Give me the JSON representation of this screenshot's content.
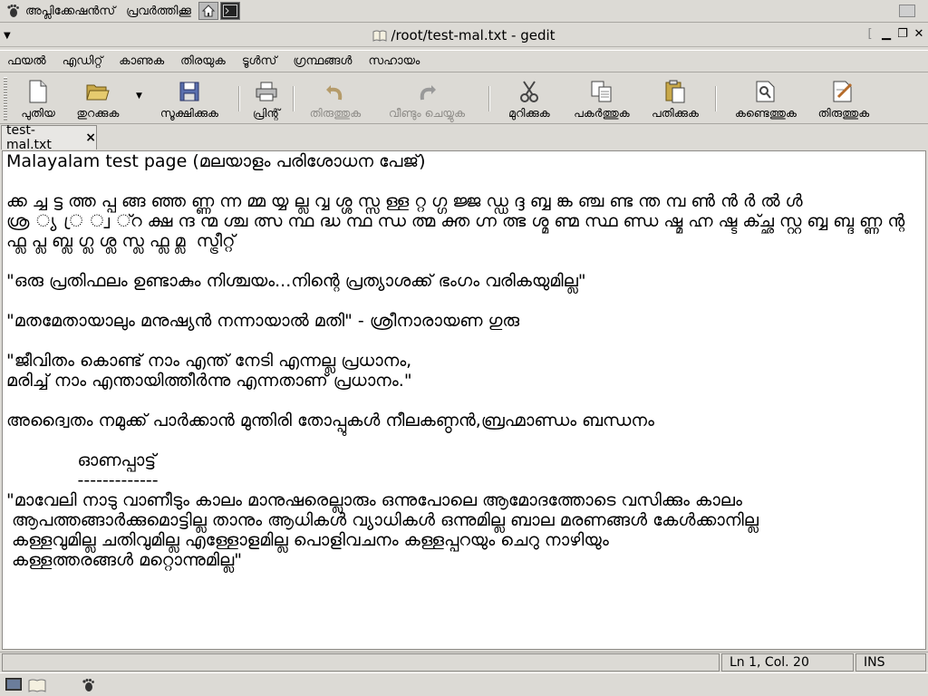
{
  "top_panel": {
    "applications_label": "അപ്ലിക്കേഷന്‍സ്",
    "actions_label": "പ്രവര്‍ത്തിക്കൂ",
    "icons": [
      "gnome-foot-icon",
      "home-launcher-icon",
      "terminal-launcher-icon",
      "network-status-icon"
    ]
  },
  "window": {
    "title": "/root/test-mal.txt - gedit"
  },
  "menubar": {
    "items": [
      "ഫയല്‍",
      "എഡിറ്റ്",
      "കാണുക",
      "തിരയുക",
      "ടൂള്‍സ്",
      "ഗ്രന്ഥങ്ങള്‍",
      "സഹായം"
    ]
  },
  "toolbar": {
    "new": "പുതിയ",
    "open": "തുറക്കുക",
    "save": "സൂക്ഷിക്കുക",
    "print": "പ്രിന്റ്",
    "undo": "തിരുത്തുക",
    "redo": "വീണ്ടും ചെയ്യുക",
    "cut": "മുറിക്കുക",
    "copy": "പകര്‍ത്തുക",
    "paste": "പതിക്കുക",
    "find": "കണ്ടെത്തുക",
    "replace": "തിരുത്തുക"
  },
  "tab": {
    "label": "test-mal.txt",
    "close": "×"
  },
  "editor": {
    "lines": [
      "Malayalam test page (മലയാളം പരിശോധന പേജ്)",
      "",
      "ക്ക ച്ച ട്ട ത്ത പ്പ ങ്ങ ഞ്ഞ ണ്ണ ന്ന മ്മ യ്യ ല്ല വ്വ ശ്ശ സ്സ ള്ള റ്റ ഗ്ഗ ജ്ജ ഡ്ഡ ദ്ദ ബ്ബ ങ്ക ഞ്ച ണ്ട ന്ത മ്പ ണ്‍ ന്‍ ര്‍ ല്‍ ള്‍",
      "ശ്ര ്യ ്ര ്വ ്റ ക്ഷ ന്ദ ന്മ ശ്ച ത്സ ന്ഥ ദ്ധ ന്ഥ ന്ധ ത്മ ക്ത ഗ്ന ത്ഭ ശ്മ ണ്മ സ്ഥ ണ്ഡ ഷ്മ ഹ്ന ഷ്ട ക്ച്ഛ സ്റ്റ ബ്ബ ബ്ദ ണ്ണ ന്റ",
      "ഫ്ല പ്ല ബ്ല ഗ്ല ശ്ല സ്ല ഫ്ല മ്ല  സ്ട്രീറ്റ്",
      "",
      "\"ഒരു പ്രതിഫലം ഉണ്ടാകും നിശ്ചയം...നിന്റെ പ്രത്യാശക്ക് ഭംഗം വരികയുമില്ല\"",
      "",
      "\"മതമേതായാലും മനുഷ്യന്‍ നന്നായാല്‍ മതി\" - ശ്രീനാരായണ ഗുരു",
      "",
      "\"ജീവിതം കൊണ്ട് നാം എന്ത് നേടി എന്നല്ല പ്രധാനം,",
      "മരിച്ച് നാം എന്തായിത്തീര്‍ന്നു എന്നതാണ് പ്രധാനം.\"",
      "",
      "അദ്വൈതം നമുക്ക് പാര്‍ക്കാന്‍ മുന്തിരി തോപ്പുകള്‍ നീലകണ്ഠന്‍,ബ്രഹ്മാണ്ഡം ബന്ധനം",
      "",
      "             ഓണപ്പാട്ട്",
      "             -------------",
      "\"മാവേലി നാടു വാണീടും കാലം മാനുഷരെല്ലാരും ഒന്നുപോലെ ആമോദത്തോടെ വസിക്കും കാലം",
      " ആപത്തങ്ങാര്‍ക്കുമൊട്ടില്ല താനും ആധികള്‍ വ്യാധികള്‍ ഒന്നുമില്ല ബാല മരണങ്ങള്‍ കേള്‍ക്കാനില്ല",
      " കള്ളവുമില്ല ചതിവുമില്ല എള്ളോളമില്ല പൊളിവചനം കള്ളപ്പറയും ചെറു നാഴിയും",
      " കള്ളത്തരങ്ങള്‍ മറ്റൊന്നുമില്ല\""
    ]
  },
  "statusbar": {
    "message": "",
    "position": "Ln 1, Col. 20",
    "mode": "INS"
  },
  "colors": {
    "panel_bg": "#dcdad5",
    "editor_bg": "#ffffff",
    "disabled_text": "#8e8c88"
  }
}
